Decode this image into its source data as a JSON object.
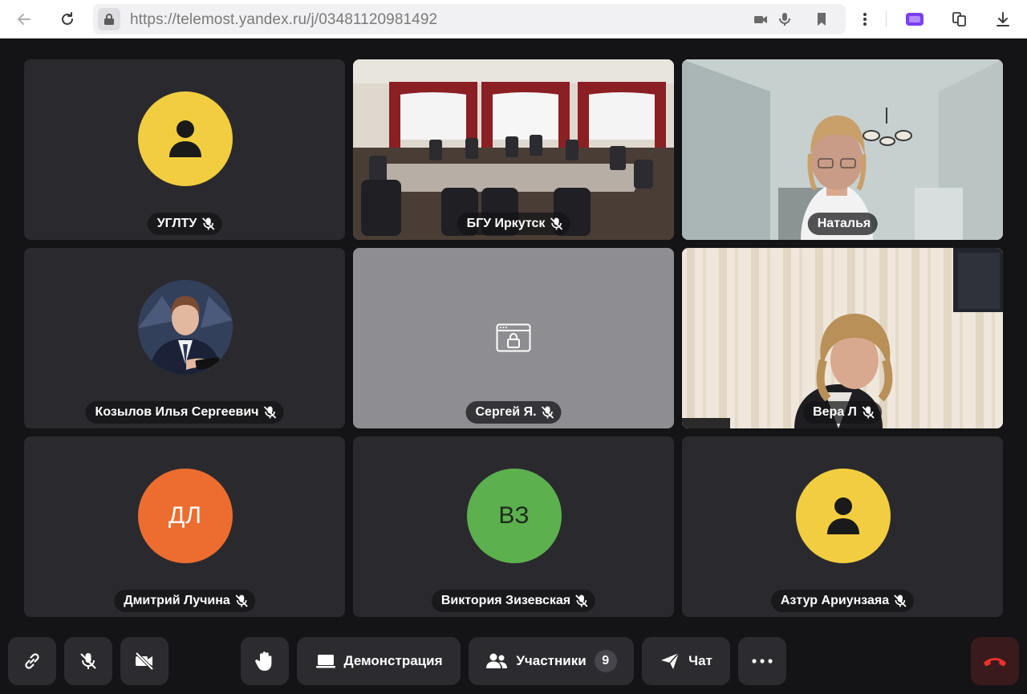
{
  "browser": {
    "url_domain": "https://telemost.yandex.ru",
    "url_path": "/j/03481120981492"
  },
  "tiles": [
    {
      "name": "УГЛТУ",
      "type": "avatar-icon",
      "color": "#f2cd3f"
    },
    {
      "name": "БГУ Иркутск",
      "type": "video"
    },
    {
      "name": "Наталья",
      "type": "video"
    },
    {
      "name": "Козылов Илья Сергеевич",
      "type": "avatar-photo"
    },
    {
      "name": "Сергей Я.",
      "type": "screen-locked"
    },
    {
      "name": "Вера Л",
      "type": "video"
    },
    {
      "name": "Дмитрий Лучина",
      "type": "avatar-initials",
      "initials": "ДЛ",
      "color": "#ec6d2f"
    },
    {
      "name": "Виктория Зизевская",
      "type": "avatar-initials",
      "initials": "ВЗ",
      "color": "#5cb04d"
    },
    {
      "name": "Азтур Ариунзаяа",
      "type": "avatar-icon",
      "color": "#f2cd3f"
    }
  ],
  "toolbar": {
    "demo_label": "Демонстрация",
    "participants_label": "Участники",
    "participants_count": "9",
    "chat_label": "Чат"
  },
  "colors": {
    "background": "#141416",
    "tile": "#2a2a2e",
    "toolbar_button": "#2c2c30",
    "end_call": "#3a1a1c",
    "end_call_icon": "#e8322b",
    "avatar_yellow": "#f2cd3f",
    "avatar_orange": "#ec6d2f",
    "avatar_green": "#5cb04d"
  }
}
